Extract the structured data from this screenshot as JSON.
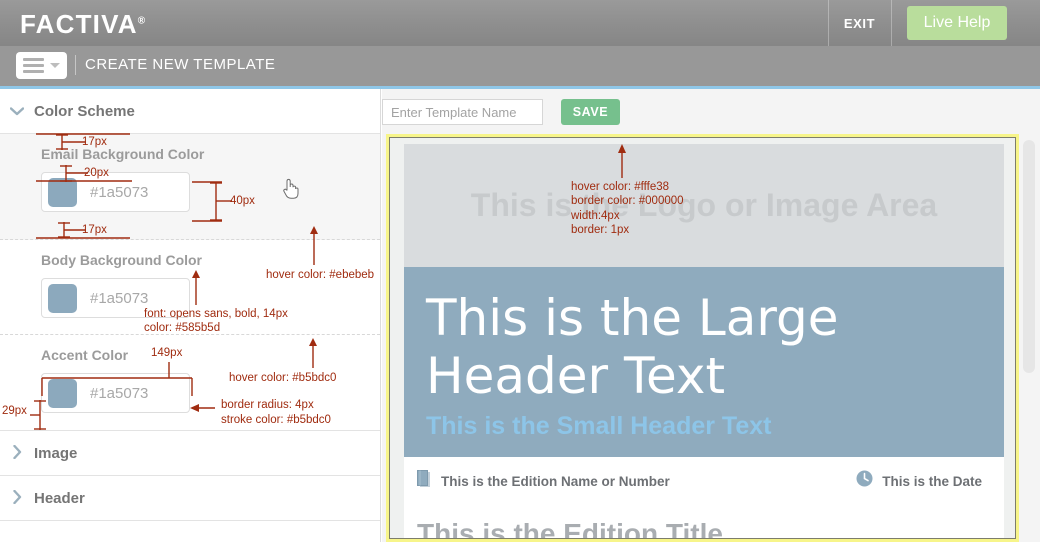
{
  "topbar": {
    "brand": "FACTIVA",
    "brand_mark": "®",
    "exit_label": "EXIT",
    "live_help_label": "Live Help",
    "live_help_color": "#b9dd9c",
    "background_color": "#8e8e8e"
  },
  "subbar": {
    "menu_icon": "hamburger-menu-icon",
    "title": "CREATE NEW TEMPLATE",
    "background_color": "#989898",
    "accent_line_color": "#8fc7e8"
  },
  "sidebar": {
    "sections": [
      {
        "label": "Color Scheme",
        "expanded": true,
        "chevron": "⌄"
      },
      {
        "label": "Image",
        "expanded": false,
        "chevron": "❯"
      },
      {
        "label": "Header",
        "expanded": false,
        "chevron": "❯"
      }
    ],
    "fields": [
      {
        "label": "Email Background Color",
        "value": "#1a5073",
        "swatch_color": "#8ca9bd"
      },
      {
        "label": "Body Background Color",
        "value": "#1a5073",
        "swatch_color": "#8ca9bd"
      },
      {
        "label": "Accent Color",
        "value": "#1a5073",
        "swatch_color": "#8ca9bd"
      }
    ]
  },
  "annotations": {
    "color": "#a02c10",
    "items": [
      {
        "id": "m-17px-top",
        "text": "17px"
      },
      {
        "id": "m-20px",
        "text": "20px"
      },
      {
        "id": "m-40px",
        "text": "40px"
      },
      {
        "id": "m-17px-bottom",
        "text": "17px"
      },
      {
        "id": "hover-ebebeb",
        "text": "hover color: #ebebeb"
      },
      {
        "id": "font-spec",
        "text": "font: opens sans, bold, 14px"
      },
      {
        "id": "color-585b5d",
        "text": "color: #585b5d"
      },
      {
        "id": "m-149px",
        "text": "149px"
      },
      {
        "id": "hover-b5bdc0",
        "text": "hover color: #b5bdc0"
      },
      {
        "id": "m-29px",
        "text": "29px"
      },
      {
        "id": "border-radius",
        "text": "border radius: 4px"
      },
      {
        "id": "stroke-color",
        "text": "stroke color: #b5bdc0"
      },
      {
        "id": "hover-fffe38",
        "text": "hover color: #fffe38"
      },
      {
        "id": "border-color",
        "text": "border color: #000000"
      },
      {
        "id": "width-4px",
        "text": "width:4px"
      },
      {
        "id": "border-1px",
        "text": "border: 1px"
      }
    ]
  },
  "toolbar": {
    "template_name_placeholder": "Enter Template Name",
    "template_name_value": "",
    "save_label": "SAVE",
    "save_color": "#76c08d"
  },
  "preview": {
    "frame_highlight_color": "#f7f58a",
    "logo_area_text": "This is the Logo or Image Area",
    "logo_area_bg": "#d9dcde",
    "header_bg": "#8fabbe",
    "large_header_line1": "This is the Large",
    "large_header_line2": "Header Text",
    "small_header": "This is the Small Header Text",
    "small_header_color": "#8dc5e8",
    "edition_name": "This is the Edition Name or Number",
    "edition_name_icon": "book-icon",
    "edition_date": "This is the Date",
    "edition_date_icon": "clock-icon",
    "edition_title": "This is the Edition Title"
  }
}
